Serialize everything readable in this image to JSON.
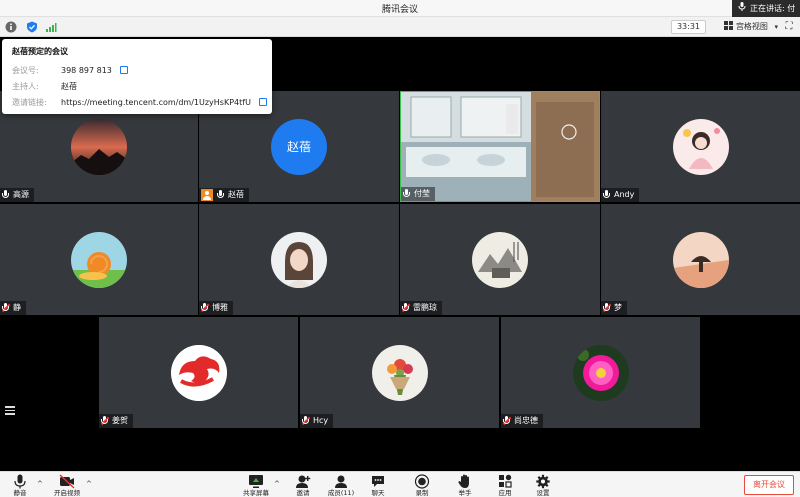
{
  "window": {
    "title": "腾讯会议",
    "speaking_label": "正在讲话: 付"
  },
  "toolbar": {
    "timer": "33:31",
    "view_label": "宫格视图",
    "view_caret": "▾",
    "fullscreen_icon": "⛶"
  },
  "meeting_info": {
    "title": "赵蓓预定的会议",
    "id_label": "会议号:",
    "id_value": "398 897 813",
    "host_label": "主持人:",
    "host_value": "赵蓓",
    "link_label": "邀请链接:",
    "link_value": "https://meeting.tencent.com/dm/1UzyHsKP4tfU"
  },
  "participants": [
    {
      "name": "高源",
      "muted": false,
      "avatar": "sunset-photo"
    },
    {
      "name": "赵蓓",
      "muted": false,
      "avatar": "text-avatar",
      "avatar_text": "赵蓓",
      "host": true
    },
    {
      "name": "付莹",
      "muted": false,
      "avatar": "video-feed"
    },
    {
      "name": "Andy",
      "muted": false,
      "avatar": "illustration-girl"
    },
    {
      "name": "静",
      "muted": true,
      "avatar": "snail-illustration"
    },
    {
      "name": "博雅",
      "muted": true,
      "avatar": "girl-photo"
    },
    {
      "name": "雷鹏琼",
      "muted": true,
      "avatar": "ink-painting"
    },
    {
      "name": "梦",
      "muted": true,
      "avatar": "paper-art"
    },
    {
      "name": "姜贺",
      "muted": true,
      "avatar": "cloud-logo"
    },
    {
      "name": "Hcy",
      "muted": true,
      "avatar": "bouquet-photo"
    },
    {
      "name": "尚忠德",
      "muted": true,
      "avatar": "pink-flower"
    }
  ],
  "bottom": {
    "mute": "静音",
    "video": "开启视频",
    "share": "共享屏幕",
    "invite": "邀请",
    "members": "成员(11)",
    "chat": "聊天",
    "record": "录制",
    "raise": "举手",
    "apps": "应用",
    "settings": "设置",
    "leave": "离开会议"
  },
  "colors": {
    "accent": "#1e7bf0",
    "leave": "#e74c3c",
    "tile": "#35383c",
    "host_badge": "#f08a24",
    "speaking_border": "#38c24b"
  }
}
